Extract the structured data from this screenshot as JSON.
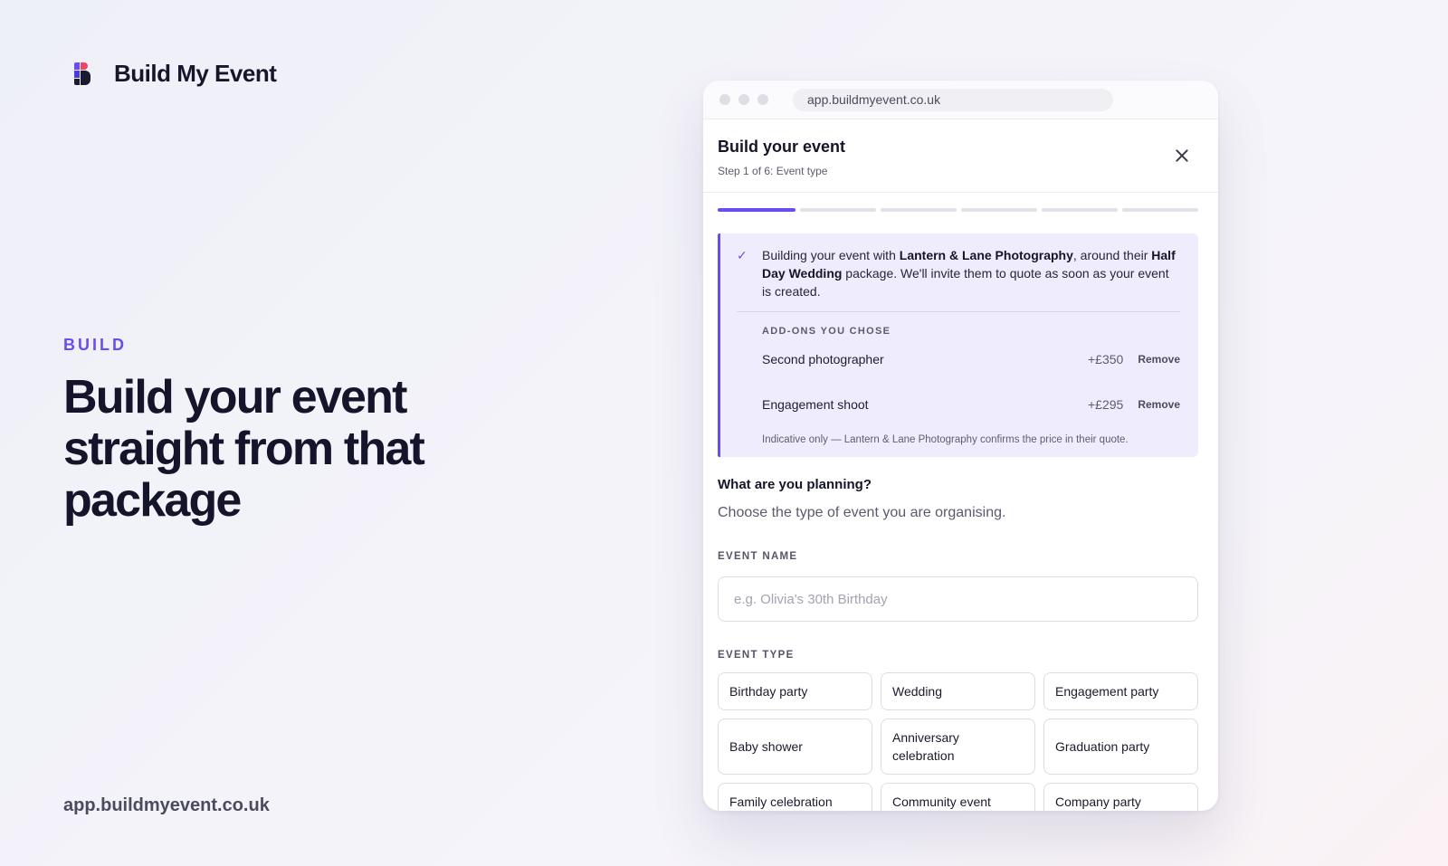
{
  "brand": {
    "name": "Build My Event",
    "logo_icon": "build-my-event-logo-icon"
  },
  "hero": {
    "eyebrow": "BUILD",
    "headline": "Build your event straight from that package"
  },
  "footer": {
    "url": "app.buildmyevent.co.uk"
  },
  "browser": {
    "url": "app.buildmyevent.co.uk"
  },
  "modal": {
    "title": "Build your event",
    "step": "Step 1 of 6: Event type",
    "close_icon": "close-icon",
    "progress": {
      "current_step": 1,
      "total_steps": 6
    }
  },
  "notice": {
    "icon": "check-icon",
    "text_prefix": "Building your event with ",
    "vendor": "Lantern & Lane Photography",
    "text_middle": ", around their ",
    "package": "Half Day Wedding",
    "text_suffix": " package. We'll invite them to quote as soon as your event is created.",
    "addons_label": "ADD-ONS YOU CHOSE",
    "addons": [
      {
        "name": "Second photographer",
        "price": "+£350",
        "action": "Remove"
      },
      {
        "name": "Engagement shoot",
        "price": "+£295",
        "action": "Remove"
      }
    ],
    "footnote": "Indicative only — Lantern & Lane Photography confirms the price in their quote."
  },
  "planning": {
    "question": "What are you planning?",
    "subtitle": "Choose the type of event you are organising."
  },
  "event_name": {
    "label": "EVENT NAME",
    "placeholder": "e.g. Olivia's 30th Birthday",
    "value": ""
  },
  "event_type": {
    "label": "EVENT TYPE",
    "options": [
      "Birthday party",
      "Wedding",
      "Engagement party",
      "Baby shower",
      "Anniversary celebration",
      "Graduation party",
      "Family celebration",
      "Community event",
      "Company party"
    ]
  },
  "colors": {
    "accent": "#6b4cf0",
    "notice_bg": "#efecfd",
    "text": "#14142b"
  }
}
